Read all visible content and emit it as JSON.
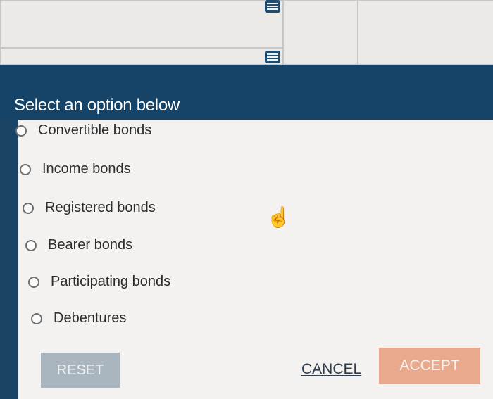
{
  "dialog": {
    "title": "Select an option below",
    "options": [
      {
        "label": "Convertible bonds"
      },
      {
        "label": "Income bonds"
      },
      {
        "label": "Registered bonds"
      },
      {
        "label": "Bearer bonds"
      },
      {
        "label": "Participating bonds"
      },
      {
        "label": "Debentures"
      }
    ],
    "buttons": {
      "reset": "RESET",
      "cancel": "CANCEL",
      "accept": "ACCEPT"
    }
  },
  "icons": [
    "list-icon",
    "list-icon",
    "pointer-hand-icon"
  ],
  "colors": {
    "header": "#154468",
    "accept": "#e8a98d",
    "reset": "#a9b6bf"
  }
}
